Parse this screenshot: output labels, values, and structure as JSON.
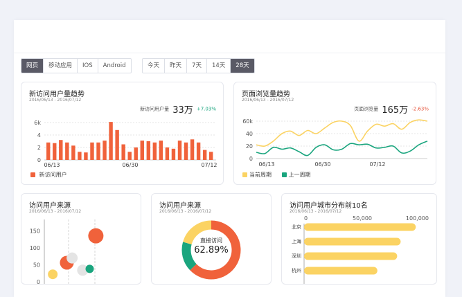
{
  "platform_tabs": [
    "网页",
    "移动应用",
    "IOS",
    "Android"
  ],
  "platform_active": 0,
  "range_tabs": [
    "今天",
    "昨天",
    "7天",
    "14天",
    "28天"
  ],
  "range_active": 4,
  "colors": {
    "primary": "#f0623b",
    "yellow": "#fbd363",
    "green": "#1aa57e",
    "grey": "#e4e4e4",
    "up": "#1aa57e",
    "down": "#e5553c",
    "active_tab": "#5a5a66"
  },
  "new_users": {
    "title": "新访问用户量趋势",
    "date": "2016/06/13 - 2016/07/12",
    "kpi_label": "新访问用户量",
    "kpi_value": "33万",
    "kpi_change": "+7.03%",
    "legend": "新访问用户"
  },
  "page_views": {
    "title": "页面浏览量趋势",
    "date": "2016/06/13 - 2016/07/12",
    "kpi_label": "页面浏览量",
    "kpi_value": "165万",
    "kpi_change": "-2.63%",
    "legend_a": "当前周期",
    "legend_b": "上一周期"
  },
  "sources_scatter": {
    "title": "访问用户来源",
    "date": "2016/06/13 - 2016/07/12"
  },
  "sources_donut": {
    "title": "访问用户来源",
    "date": "2016/06/13 - 2016/07/12",
    "center_label": "直接访问",
    "center_value": "62.89%"
  },
  "cities": {
    "title": "访问用户城市分布前10名",
    "date": "2016/06/13 - 2016/07/12"
  },
  "chart_data": [
    {
      "type": "bar",
      "title": "新访问用户量趋势",
      "x_ticks": [
        "06/13",
        "06/30",
        "07/12"
      ],
      "y_ticks": [
        "6k",
        "4",
        "2",
        "0"
      ],
      "ylim": [
        0,
        7
      ],
      "values": [
        2.8,
        2.7,
        3.2,
        2.8,
        2.3,
        1.3,
        1.2,
        2.8,
        2.8,
        3.1,
        6.1,
        4.8,
        2.5,
        1.3,
        2.0,
        3.1,
        3.0,
        2.8,
        3.1,
        2.0,
        1.8,
        3.1,
        2.8,
        3.3,
        2.8,
        1.6,
        1.3
      ],
      "series_name": "新访问用户",
      "grid": true
    },
    {
      "type": "line",
      "title": "页面浏览量趋势",
      "x_ticks": [
        "06/13",
        "06/30",
        "07/12"
      ],
      "y_ticks": [
        "60k",
        "40",
        "20",
        "0"
      ],
      "ylim": [
        0,
        70
      ],
      "series": [
        {
          "name": "当前周期",
          "values": [
            22,
            20,
            28,
            40,
            44,
            37,
            45,
            40,
            49,
            58,
            60,
            53,
            28,
            44,
            55,
            52,
            56,
            47,
            58,
            62,
            60
          ]
        },
        {
          "name": "上一周期",
          "values": [
            10,
            8,
            18,
            15,
            17,
            11,
            5,
            18,
            22,
            14,
            15,
            24,
            22,
            23,
            17,
            18,
            20,
            9,
            12,
            22,
            28
          ]
        }
      ]
    },
    {
      "type": "scatter",
      "title": "访问用户来源",
      "y_ticks": [
        "150",
        "100",
        "50",
        "0"
      ],
      "ylim": [
        0,
        175
      ],
      "points": [
        {
          "x": 0.08,
          "y": 22,
          "r": 7,
          "color": "yellow"
        },
        {
          "x": 0.24,
          "y": 56,
          "r": 10,
          "color": "primary"
        },
        {
          "x": 0.3,
          "y": 70,
          "r": 8,
          "color": "grey"
        },
        {
          "x": 0.42,
          "y": 34,
          "r": 8,
          "color": "grey"
        },
        {
          "x": 0.5,
          "y": 38,
          "r": 6,
          "color": "green"
        },
        {
          "x": 0.57,
          "y": 135,
          "r": 11,
          "color": "primary"
        }
      ]
    },
    {
      "type": "pie",
      "title": "访问用户来源",
      "slices": [
        {
          "value": 62.89,
          "color": "primary"
        },
        {
          "value": 16.5,
          "color": "green"
        },
        {
          "value": 20.61,
          "color": "yellow"
        }
      ]
    },
    {
      "type": "bar",
      "orientation": "horizontal",
      "title": "访问用户城市分布前10名",
      "x_ticks": [
        "0",
        "50,000",
        "100,000"
      ],
      "xlim": [
        0,
        100000
      ],
      "categories": [
        "北京",
        "上海",
        "深圳",
        "杭州"
      ],
      "values": [
        96000,
        83000,
        80000,
        63000
      ]
    }
  ]
}
